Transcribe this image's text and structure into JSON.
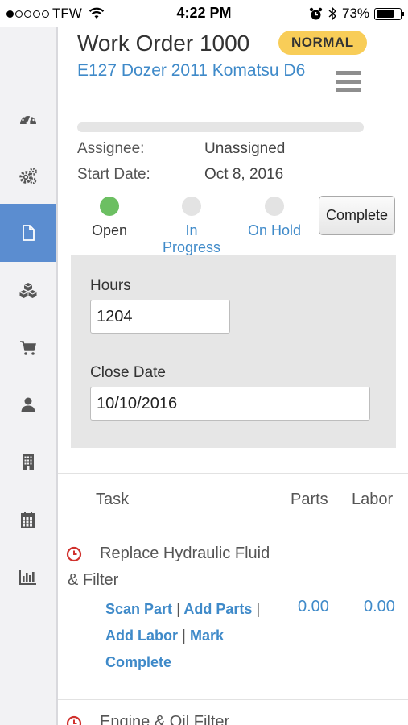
{
  "status_bar": {
    "carrier": "TFW",
    "time": "4:22 PM",
    "battery": "73%",
    "battery_level": 0.73
  },
  "sidebar": {
    "items": [
      {
        "icon": "dashboard-icon",
        "active": false
      },
      {
        "icon": "gears-icon",
        "active": false
      },
      {
        "icon": "document-icon",
        "active": true
      },
      {
        "icon": "cubes-icon",
        "active": false
      },
      {
        "icon": "cart-icon",
        "active": false
      },
      {
        "icon": "user-icon",
        "active": false
      },
      {
        "icon": "building-icon",
        "active": false
      },
      {
        "icon": "calendar-icon",
        "active": false
      },
      {
        "icon": "bar-chart-icon",
        "active": false
      }
    ],
    "active_color": "#5b8dd0"
  },
  "work_order": {
    "title": "Work Order 1000",
    "priority": "NORMAL",
    "asset": "E127 Dozer 2011 Komatsu D6",
    "progress": 0,
    "assignee_label": "Assignee:",
    "assignee": "Unassigned",
    "start_date_label": "Start Date:",
    "start_date": "Oct 8, 2016"
  },
  "status_steps": [
    {
      "label": "Open",
      "current": true
    },
    {
      "label": "In Progress",
      "current": false
    },
    {
      "label": "On Hold",
      "current": false
    }
  ],
  "complete_button": "Complete",
  "form": {
    "hours_label": "Hours",
    "hours_value": "1204",
    "close_date_label": "Close Date",
    "close_date_value": "10/10/2016"
  },
  "tasks": {
    "headers": {
      "task": "Task",
      "parts": "Parts",
      "labor": "Labor"
    },
    "rows": [
      {
        "name": "Replace Hydraulic Fluid & Filter",
        "actions": {
          "scan_part": "Scan Part",
          "add_parts": "Add Parts",
          "add_labor": "Add Labor",
          "mark_complete": "Mark Complete"
        },
        "parts": "0.00",
        "labor": "0.00"
      },
      {
        "name": "Engine & Oil Filter"
      }
    ]
  },
  "colors": {
    "link": "#3f8ac9",
    "badge": "#f8cd58",
    "open_dot": "#6cbf62",
    "alert": "#d0312d"
  }
}
